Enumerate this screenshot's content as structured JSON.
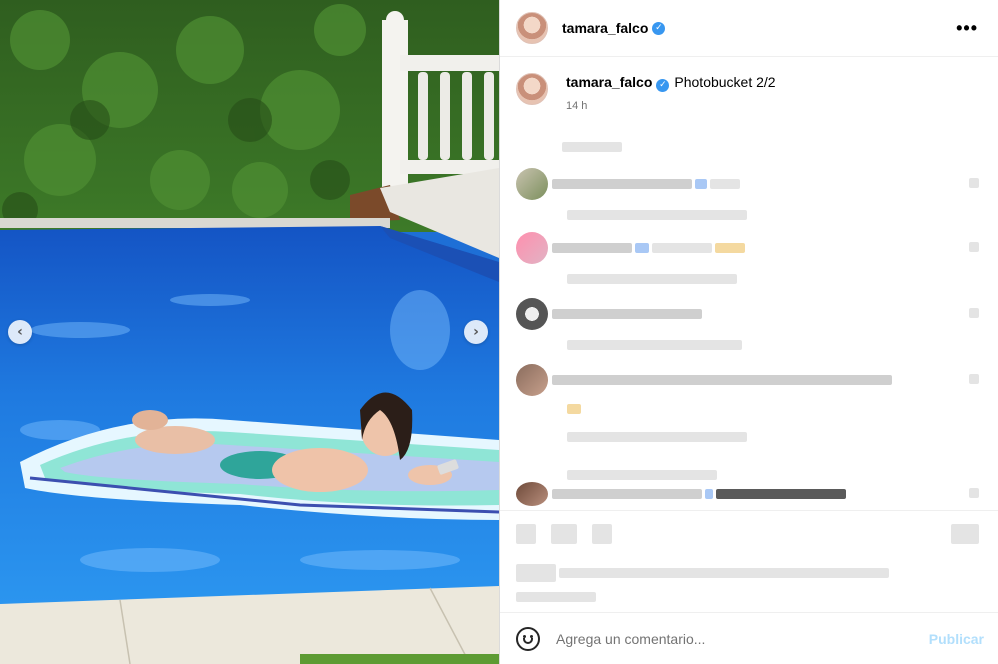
{
  "post": {
    "username": "tamara_falco",
    "caption_text": "Photobucket 2/2",
    "time_ago": "14 h"
  },
  "media": {
    "prev_glyph": "‹",
    "next_glyph": "›"
  },
  "icons": {
    "verified": "✓",
    "more": "•••"
  },
  "comment": {
    "placeholder": "Agrega un comentario...",
    "publish_label": "Publicar"
  },
  "colors": {
    "accent": "#3897f0",
    "publish_disabled": "#b2dffc",
    "pool": "#1e6fd6"
  }
}
